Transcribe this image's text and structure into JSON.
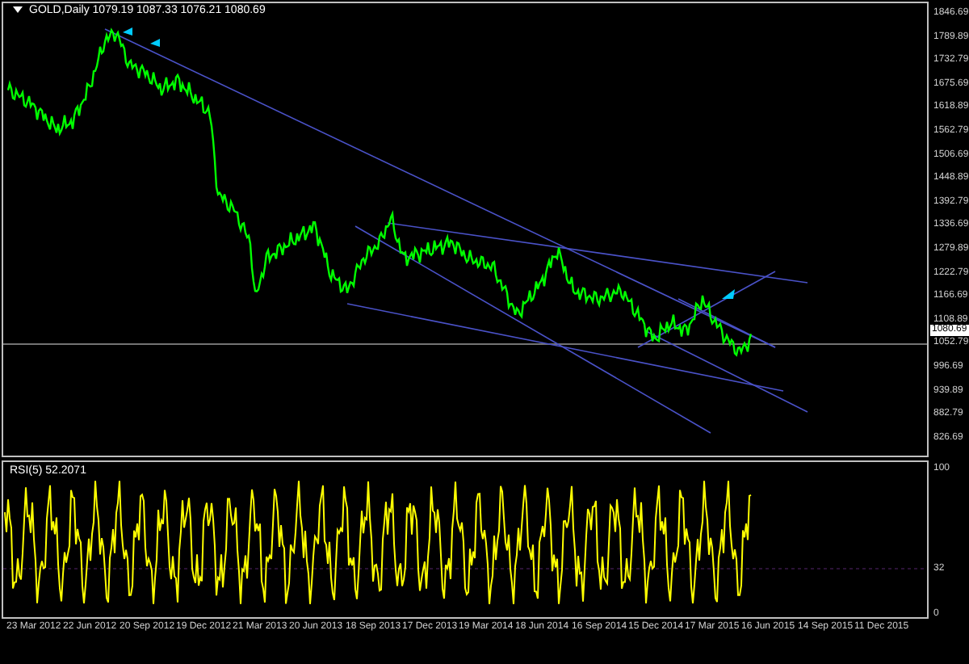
{
  "chart": {
    "title": "GOLD,Daily 1079.19 1087.33 1076.21 1080.69",
    "price_labels": [
      {
        "text": "1846.69",
        "current": false
      },
      {
        "text": "1789.89",
        "current": false
      },
      {
        "text": "1732.79",
        "current": false
      },
      {
        "text": "1675.69",
        "current": false
      },
      {
        "text": "1618.89",
        "current": false
      },
      {
        "text": "1562.79",
        "current": false
      },
      {
        "text": "1506.69",
        "current": false
      },
      {
        "text": "1448.89",
        "current": false
      },
      {
        "text": "1392.79",
        "current": false
      },
      {
        "text": "1336.69",
        "current": false
      },
      {
        "text": "1279.89",
        "current": false
      },
      {
        "text": "1222.79",
        "current": false
      },
      {
        "text": "1166.69",
        "current": false
      },
      {
        "text": "1108.89",
        "current": false
      },
      {
        "text": "1080.69",
        "current": true
      },
      {
        "text": "1052.79",
        "current": false
      },
      {
        "text": "996.69",
        "current": false
      },
      {
        "text": "939.89",
        "current": false
      },
      {
        "text": "882.79",
        "current": false
      },
      {
        "text": "826.69",
        "current": false
      }
    ],
    "indicator": {
      "title": "RSI(5) 52.2071",
      "labels": [
        "100",
        "32",
        "0"
      ]
    },
    "date_labels": [
      "23 Mar 2012",
      "22 Jun 2012",
      "20 Sep 2012",
      "19 Dec 2012",
      "21 Mar 2013",
      "20 Jun 2013",
      "18 Sep 2013",
      "17 Dec 2013",
      "19 Mar 2014",
      "18 Jun 2014",
      "16 Sep 2014",
      "15 Dec 2014",
      "17 Mar 2015",
      "16 Jun 2015",
      "14 Sep 2015",
      "11 Dec 2015"
    ]
  }
}
